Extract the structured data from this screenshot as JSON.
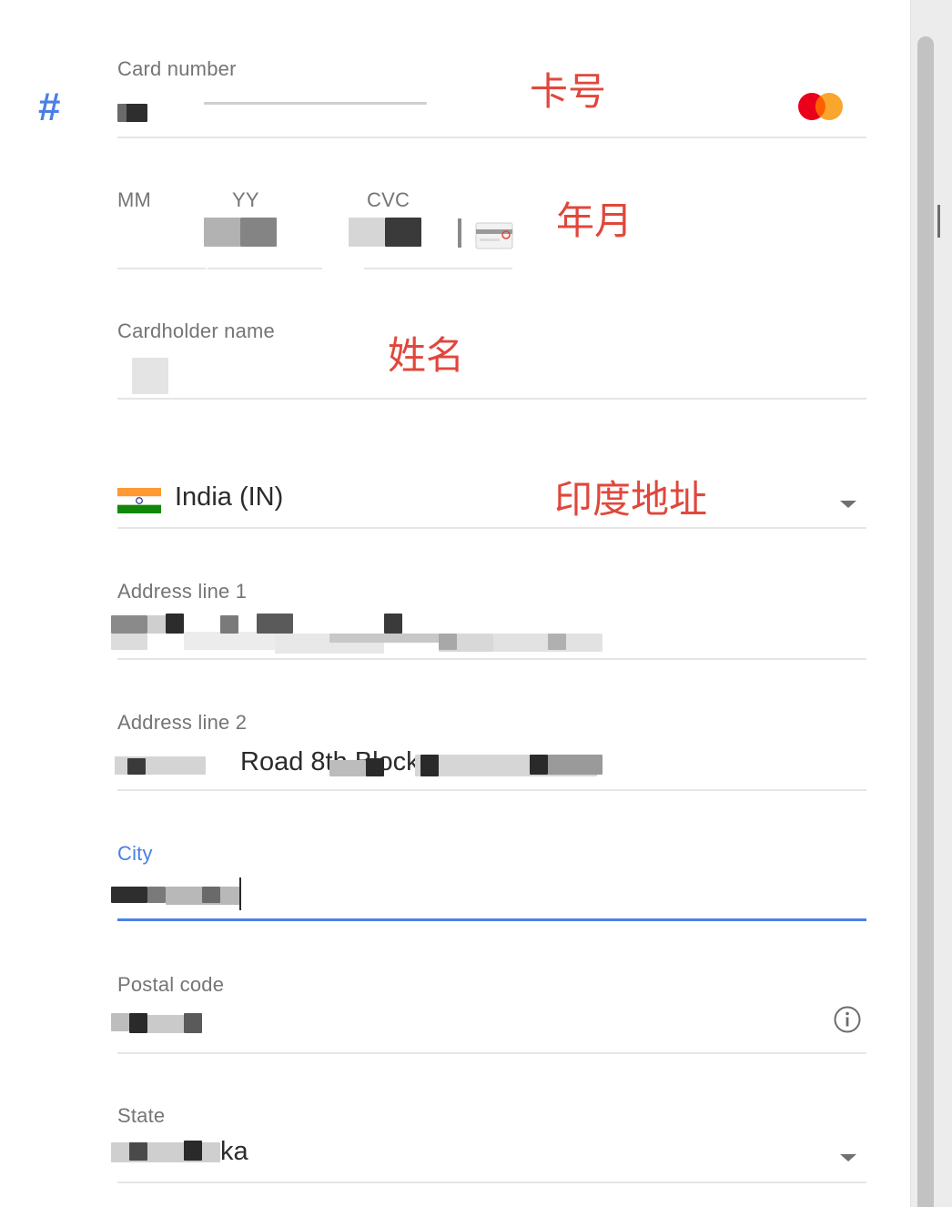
{
  "card": {
    "label": "Card number",
    "annotation": "卡号",
    "value_masked": "",
    "brand_icon": "mastercard-icon",
    "brand_colors": [
      "#eb001b",
      "#f79e1b"
    ]
  },
  "expiry": {
    "month_label": "MM",
    "year_label": "YY",
    "cvc_label": "CVC",
    "annotation": "年月"
  },
  "cardholder": {
    "label": "Cardholder name",
    "annotation": "姓名"
  },
  "country": {
    "value": "India (IN)",
    "annotation": "印度地址",
    "flag_icon": "india-flag-icon"
  },
  "address1": {
    "label": "Address line 1"
  },
  "address2": {
    "label": "Address line 2",
    "visible_fragment": "Road 8th Block"
  },
  "city": {
    "label": "City"
  },
  "postal": {
    "label": "Postal code",
    "info_icon": "info-icon"
  },
  "state": {
    "label": "State",
    "visible_fragment": "ka"
  },
  "colors": {
    "accent": "#4a80e6",
    "annotation": "#e0473c",
    "label": "#757575",
    "divider": "#e6e6e6"
  }
}
